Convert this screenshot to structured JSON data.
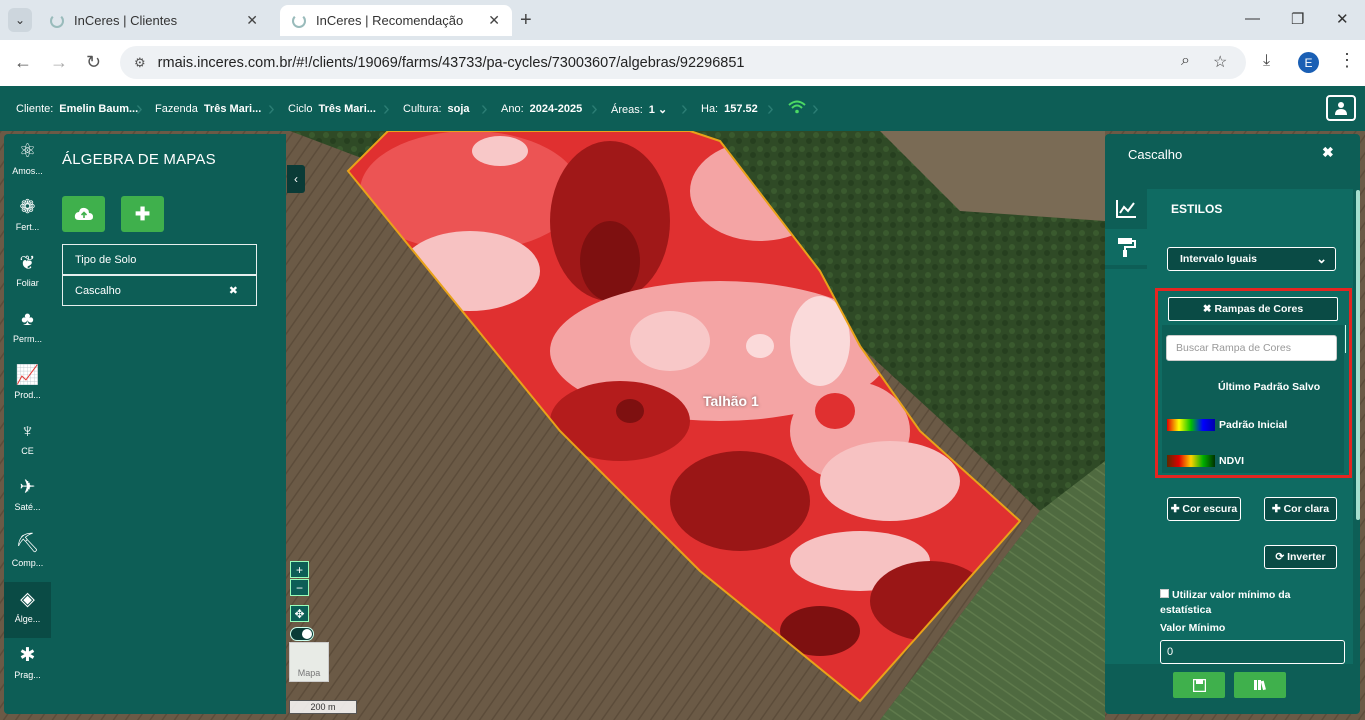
{
  "browser": {
    "tabs": [
      {
        "title": "InCeres | Clientes"
      },
      {
        "title": "InCeres | Recomendação"
      }
    ],
    "url": "rmais.inceres.com.br/#!/clients/19069/farms/43733/pa-cycles/73003607/algebras/92296851",
    "profile_initial": "E"
  },
  "header": {
    "cliente_label": "Cliente:",
    "cliente_value": "Emelin Baum...",
    "fazenda_label": "Fazenda",
    "fazenda_value": "Três Mari...",
    "ciclo_label": "Ciclo",
    "ciclo_value": "Três Mari...",
    "cultura_label": "Cultura:",
    "cultura_value": "soja",
    "ano_label": "Ano:",
    "ano_value": "2024-2025",
    "areas_label": "Áreas:",
    "areas_value": "1",
    "ha_label": "Ha:",
    "ha_value": "157.52"
  },
  "sidebar": {
    "items": [
      {
        "label": "Amos...",
        "icon": "sample-icon"
      },
      {
        "label": "Fert...",
        "icon": "fertility-icon"
      },
      {
        "label": "Foliar",
        "icon": "leaf-icon"
      },
      {
        "label": "Perm...",
        "icon": "permanent-crop-icon"
      },
      {
        "label": "Prod...",
        "icon": "productivity-icon"
      },
      {
        "label": "CE",
        "icon": "sprout-icon"
      },
      {
        "label": "Saté...",
        "icon": "satellite-icon"
      },
      {
        "label": "Comp...",
        "icon": "compaction-icon"
      },
      {
        "label": "Álge...",
        "icon": "layers-icon"
      },
      {
        "label": "Prag...",
        "icon": "bug-icon"
      }
    ]
  },
  "algebra": {
    "title": "ÁLGEBRA DE MAPAS",
    "layers": [
      {
        "name": "Tipo de Solo"
      },
      {
        "name": "Cascalho",
        "close": "✖"
      }
    ]
  },
  "map": {
    "field_label": "Talhão 1",
    "zoom_in": "+",
    "zoom_out": "−",
    "basemap_label": "Mapa",
    "scale_label": "200 m"
  },
  "style_panel": {
    "title": "Cascalho",
    "section": "ESTILOS",
    "classification": "Intervalo Iguais",
    "ramp_button": "✖ Rampas de Cores",
    "ramp_search_placeholder": "Buscar Rampa de Cores",
    "ramps": [
      {
        "name": "Último Padrão Salvo"
      },
      {
        "name": "Padrão Inicial"
      },
      {
        "name": "NDVI"
      }
    ],
    "dark_color_button": "✚ Cor escura",
    "light_color_button": "✚ Cor clara",
    "invert_button": "⟳ Inverter",
    "min_stat_checkbox": "Utilizar valor mínimo da estatística",
    "min_value_label": "Valor Mínimo",
    "min_value": "0"
  },
  "colors": {
    "brand_teal": "#0d5e56",
    "accent_green": "#3fb04c",
    "highlight_red": "#e52521"
  }
}
